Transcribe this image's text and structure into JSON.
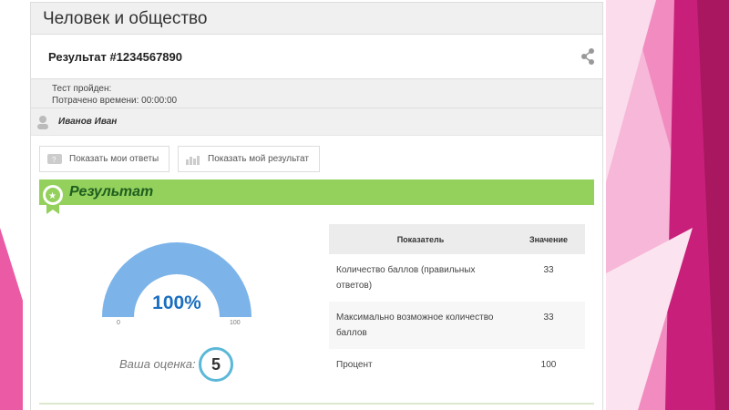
{
  "header": {
    "title": "Человек и общество"
  },
  "result": {
    "title": "Результат #1234567890"
  },
  "info": {
    "passed": "Тест пройден:",
    "time": "Потрачено времени: 00:00:00"
  },
  "user": {
    "name": "Иванов Иван"
  },
  "buttons": {
    "answers": "Показать мои ответы",
    "result": "Показать мой результат"
  },
  "section": {
    "title": "Результат"
  },
  "gauge": {
    "value": 100,
    "label": "100%",
    "min": "0",
    "max": "100",
    "color": "#7cb4ea"
  },
  "grade": {
    "label": "Ваша оценка:",
    "value": "5"
  },
  "table": {
    "headers": [
      "Показатель",
      "Значение"
    ],
    "rows": [
      {
        "name": "Количество баллов (правильных ответов)",
        "value": "33"
      },
      {
        "name": "Максимально возможное количество баллов",
        "value": "33"
      },
      {
        "name": "Процент",
        "value": "100"
      }
    ]
  },
  "colors": {
    "accent_green": "#93d05c",
    "pink": "#e0358f"
  }
}
